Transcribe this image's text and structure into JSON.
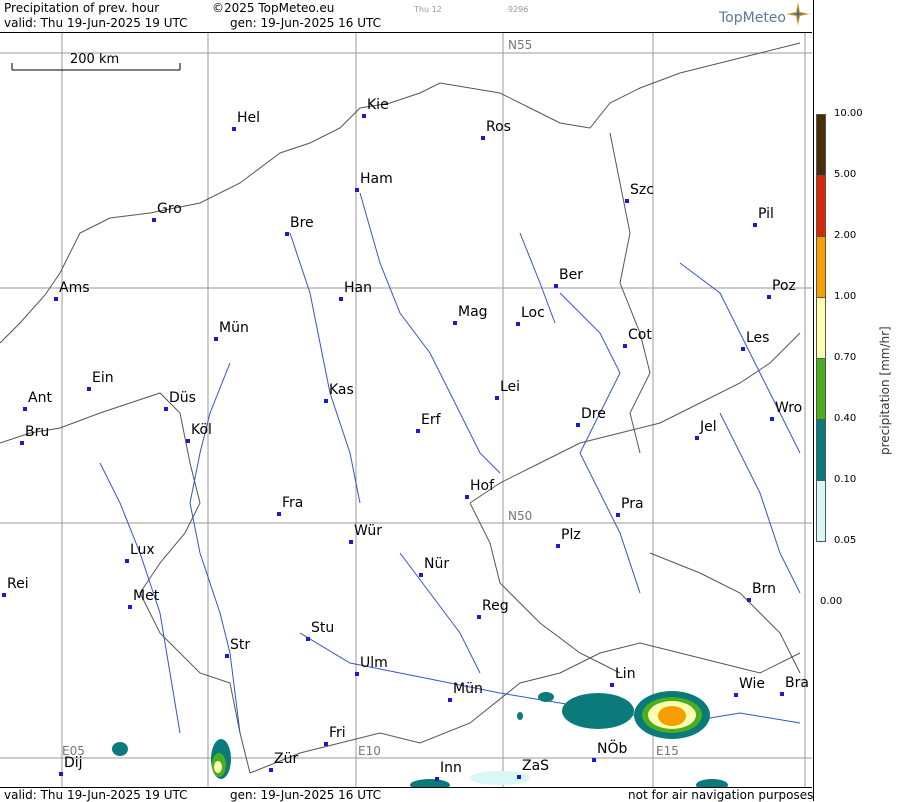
{
  "header": {
    "title": "Precipitation of prev. hour",
    "copyright": "©2025 TopMeteo.eu",
    "valid": "valid:  Thu  19-Jun-2025  19 UTC",
    "gen": "gen: 19-Jun-2025 16 UTC",
    "small_day": "Thu 12",
    "small_code": "9296",
    "logo": "TopMeteo"
  },
  "footer": {
    "valid": "valid:  Thu  19-Jun-2025  19 UTC",
    "gen": "gen: 19-Jun-2025 16 UTC",
    "notice": "not for air navigation purposes"
  },
  "map": {
    "scale_label": "200 km",
    "gridlabels": [
      "N55",
      "N50",
      "E05",
      "E10",
      "E15"
    ],
    "cities": [
      "Hel",
      "Kie",
      "Ros",
      "Ham",
      "Szc",
      "Gro",
      "Bre",
      "Pil",
      "Ber",
      "Ams",
      "Han",
      "Poz",
      "Mag",
      "Loc",
      "Mün",
      "Cot",
      "Les",
      "Ein",
      "Kas",
      "Lei",
      "Ant",
      "Düs",
      "Wro",
      "Erf",
      "Dre",
      "Bru",
      "Köl",
      "Jel",
      "Hof",
      "Fra",
      "Pra",
      "Würz",
      "Lux",
      "Plz",
      "Nür",
      "Rei",
      "Met",
      "Brn",
      "Reg",
      "Stu",
      "Str",
      "Ulm",
      "Lin",
      "Wie",
      "Bra",
      "Mün2",
      "Fri",
      "NÖb",
      "Dij",
      "Zür",
      "Inn",
      "ZaS"
    ],
    "city_labels": {
      "Hel": "Hel",
      "Kie": "Kie",
      "Ros": "Ros",
      "Ham": "Ham",
      "Szc": "Szc",
      "Gro": "Gro",
      "Bre": "Bre",
      "Pil": "Pil",
      "Ber": "Ber",
      "Ams": "Ams",
      "Han": "Han",
      "Poz": "Poz",
      "Mag": "Mag",
      "Loc": "Loc",
      "Mün": "Mün",
      "Cot": "Cot",
      "Les": "Les",
      "Ein": "Ein",
      "Kas": "Kas",
      "Lei": "Lei",
      "Ant": "Ant",
      "Düs": "Düs",
      "Wro": "Wro",
      "Erf": "Erf",
      "Dre": "Dre",
      "Bru": "Bru",
      "Köl": "Köl",
      "Jel": "Jel",
      "Hof": "Hof",
      "Fra": "Fra",
      "Pra": "Pra",
      "Würz": "Wür",
      "Lux": "Lux",
      "Plz": "Plz",
      "Nür": "Nür",
      "Rei": "Rei",
      "Met": "Met",
      "Brn": "Brn",
      "Reg": "Reg",
      "Stu": "Stu",
      "Str": "Str",
      "Ulm": "Ulm",
      "Lin": "Lin",
      "Wie": "Wie",
      "Bra": "Bra",
      "Mün2": "Mün",
      "Fri": "Fri",
      "NÖb": "NÖb",
      "Dij": "Dij",
      "Zür": "Zür",
      "Inn": "Inn",
      "ZaS": "ZaS"
    }
  },
  "legend": {
    "unit_label": "precipitation  [mm/hr]",
    "ticks": [
      "10.00",
      "5.00",
      "2.00",
      "1.00",
      "0.70",
      "0.40",
      "0.10",
      "0.05",
      "0.00"
    ],
    "colors": [
      "#4a2e0a",
      "#d42a0a",
      "#f5a000",
      "#ffffb0",
      "#4aae1e",
      "#0a7a7a",
      "#d8f8f8"
    ]
  }
}
